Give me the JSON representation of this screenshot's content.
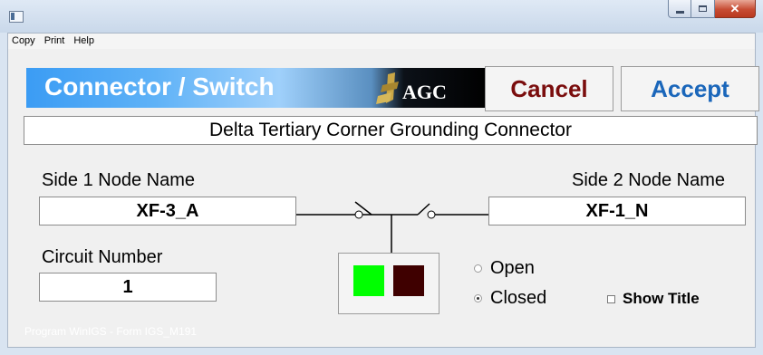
{
  "window": {
    "title": ""
  },
  "menu": {
    "copy": "Copy",
    "print": "Print",
    "help": "Help"
  },
  "banner": {
    "title": "Connector / Switch",
    "logo_text": "AGC"
  },
  "buttons": {
    "cancel": "Cancel",
    "accept": "Accept"
  },
  "title_field": {
    "value": "Delta Tertiary Corner Grounding Connector"
  },
  "side1": {
    "label": "Side 1 Node Name",
    "value": "XF-3_A"
  },
  "side2": {
    "label": "Side 2 Node Name",
    "value": "XF-1_N"
  },
  "circuit": {
    "label": "Circuit Number",
    "value": "1"
  },
  "state": {
    "open_label": "Open",
    "closed_label": "Closed",
    "selected": "Closed"
  },
  "show_title": {
    "label": "Show Title",
    "checked": false
  },
  "colors": {
    "swatch_1": "#00ff00",
    "swatch_2": "#3f0000",
    "banner_blue": "#3b9cf4",
    "cancel_text": "#7a0d0d",
    "accept_text": "#1a66ba"
  },
  "footer": {
    "text": "Program WinIGS - Form IGS_M191"
  }
}
